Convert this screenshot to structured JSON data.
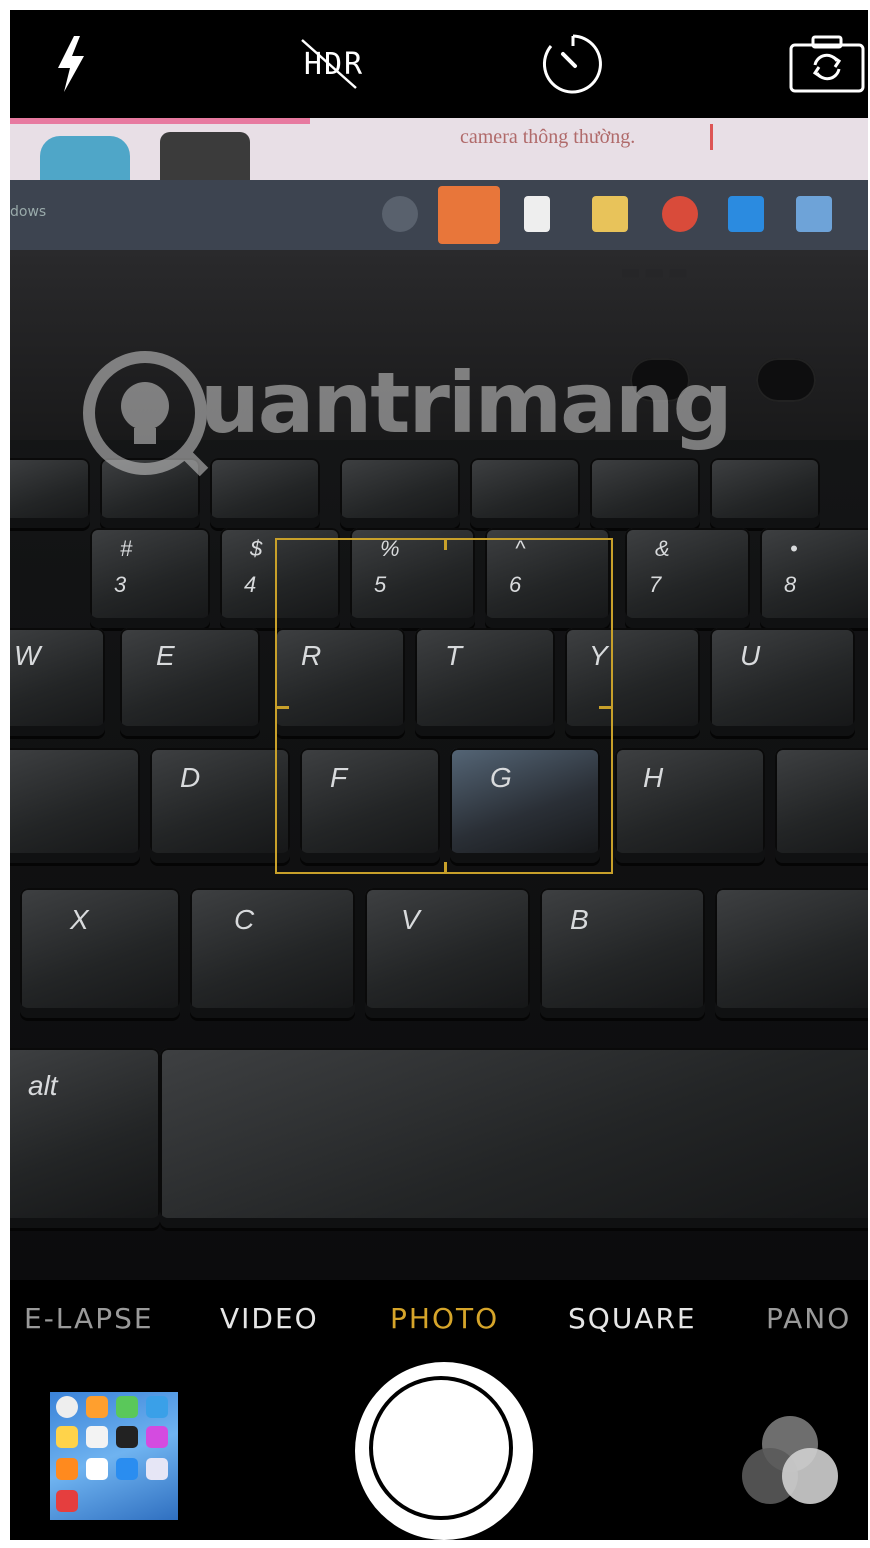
{
  "top_controls": {
    "flash_icon": "flash-icon",
    "hdr_label": "HDR",
    "timer_icon": "timer-icon",
    "switch_camera_icon": "switch-camera-icon"
  },
  "viewfinder": {
    "screen_caption": "camera thông thường.",
    "taskbar_label": "dows",
    "watermark": "uantrimang",
    "keys": {
      "row_numbers": [
        {
          "top": "#",
          "main": "3"
        },
        {
          "top": "$",
          "main": "4"
        },
        {
          "top": "%",
          "main": "5"
        },
        {
          "top": "^",
          "main": "6"
        },
        {
          "top": "&",
          "main": "7"
        },
        {
          "top": "•",
          "main": "8"
        }
      ],
      "row_qwerty": [
        "W",
        "E",
        "R",
        "T",
        "Y",
        "U"
      ],
      "row_asdf": [
        "D",
        "F",
        "G",
        "H"
      ],
      "row_zxcv": [
        "X",
        "C",
        "V",
        "B"
      ],
      "alt_label": "alt"
    }
  },
  "modes": {
    "items": [
      "E-LAPSE",
      "VIDEO",
      "PHOTO",
      "SQUARE",
      "PANO"
    ],
    "active": "PHOTO"
  },
  "bottom": {
    "gallery_icon": "gallery-thumbnail",
    "shutter_icon": "shutter-button",
    "filters_icon": "filters-icon"
  },
  "colors": {
    "accent": "#d6a52a",
    "background": "#000000"
  }
}
